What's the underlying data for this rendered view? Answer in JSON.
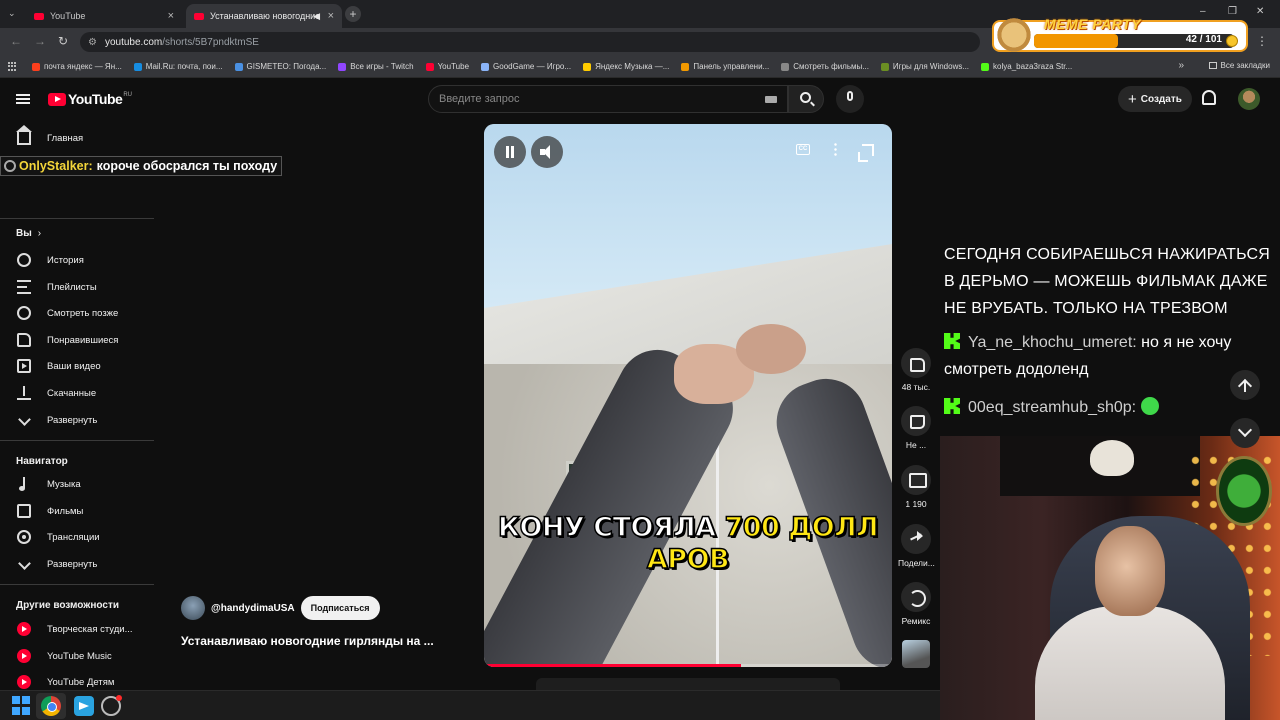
{
  "browser": {
    "tabs": [
      {
        "title": "YouTube",
        "active": false
      },
      {
        "title": "Устанавливаю новогодние",
        "active": true
      }
    ],
    "url_host": "youtube.com",
    "url_path": "/shorts/5B7pndktmSE",
    "bookmarks": [
      {
        "label": "почта яндекс — Ян...",
        "color": "#fc3f1d"
      },
      {
        "label": "Mail.Ru: почта, пои...",
        "color": "#168de2"
      },
      {
        "label": "GISMETEO: Погода...",
        "color": "#4a90e2"
      },
      {
        "label": "Все игры - Twitch",
        "color": "#9146ff"
      },
      {
        "label": "YouTube",
        "color": "#ff0033"
      },
      {
        "label": "GoodGame — Игро...",
        "color": "#8ab4f8"
      },
      {
        "label": "Яндекс Музыка —...",
        "color": "#ffcc00"
      },
      {
        "label": "Панель управлени...",
        "color": "#f29900"
      },
      {
        "label": "Смотреть фильмы...",
        "color": "#888888"
      },
      {
        "label": "Игры для Windows...",
        "color": "#6b8e23"
      },
      {
        "label": "kolya_baza3raza Str...",
        "color": "#53fc18"
      }
    ],
    "bookmarks_right": "Все закладки"
  },
  "overlay": {
    "meme_title": "MEME PARTY",
    "meme_count": "42 / 101",
    "meme_progress": 0.42
  },
  "youtube": {
    "logo": "YouTube",
    "logo_region": "RU",
    "search_placeholder": "Введите запрос",
    "create_label": "Создать"
  },
  "sidebar": {
    "home": "Главная",
    "you_heading": "Вы",
    "you_items": [
      "История",
      "Плейлисты",
      "Смотреть позже",
      "Понравившиеся",
      "Ваши видео",
      "Скачанные",
      "Развернуть"
    ],
    "nav_heading": "Навигатор",
    "nav_items": [
      "Музыка",
      "Фильмы",
      "Трансляции",
      "Развернуть"
    ],
    "more_heading": "Другие возможности",
    "more_items": [
      "Творческая студи...",
      "YouTube Music",
      "YouTube Детям"
    ]
  },
  "chat_top_left": {
    "user": "OnlyStalker:",
    "message": "короче обосрался ты походу"
  },
  "short": {
    "caption_line1_white": "КОНУ СТОЯЛА ",
    "caption_line1_yellow": "700 ДОЛЛ",
    "caption_line2_yellow": "АРОВ",
    "channel": "@handydimaUSA",
    "subscribe": "Подписаться",
    "title": "Устанавливаю новогодние гирлянды на ...",
    "progress": 0.63,
    "cc_label": "CC"
  },
  "actions": {
    "likes": "48 тыс.",
    "dislike": "Не ...",
    "comments": "1 190",
    "share": "Подели...",
    "remix": "Ремикс"
  },
  "chat_right": {
    "first": "СЕГОДНЯ СОБИРАЕШЬСЯ НАЖИРАТЬСЯ В ДЕРЬМО — МОЖЕШЬ ФИЛЬМАК ДАЖЕ НЕ ВРУБАТЬ. ТОЛЬКО НА ТРЕЗВОМ",
    "msg2_user": "Ya_ne_khochu_umeret:",
    "msg2_text": "но я не хочу смотреть додоленд",
    "msg3_user": "00eq_streamhub_sh0p:"
  }
}
